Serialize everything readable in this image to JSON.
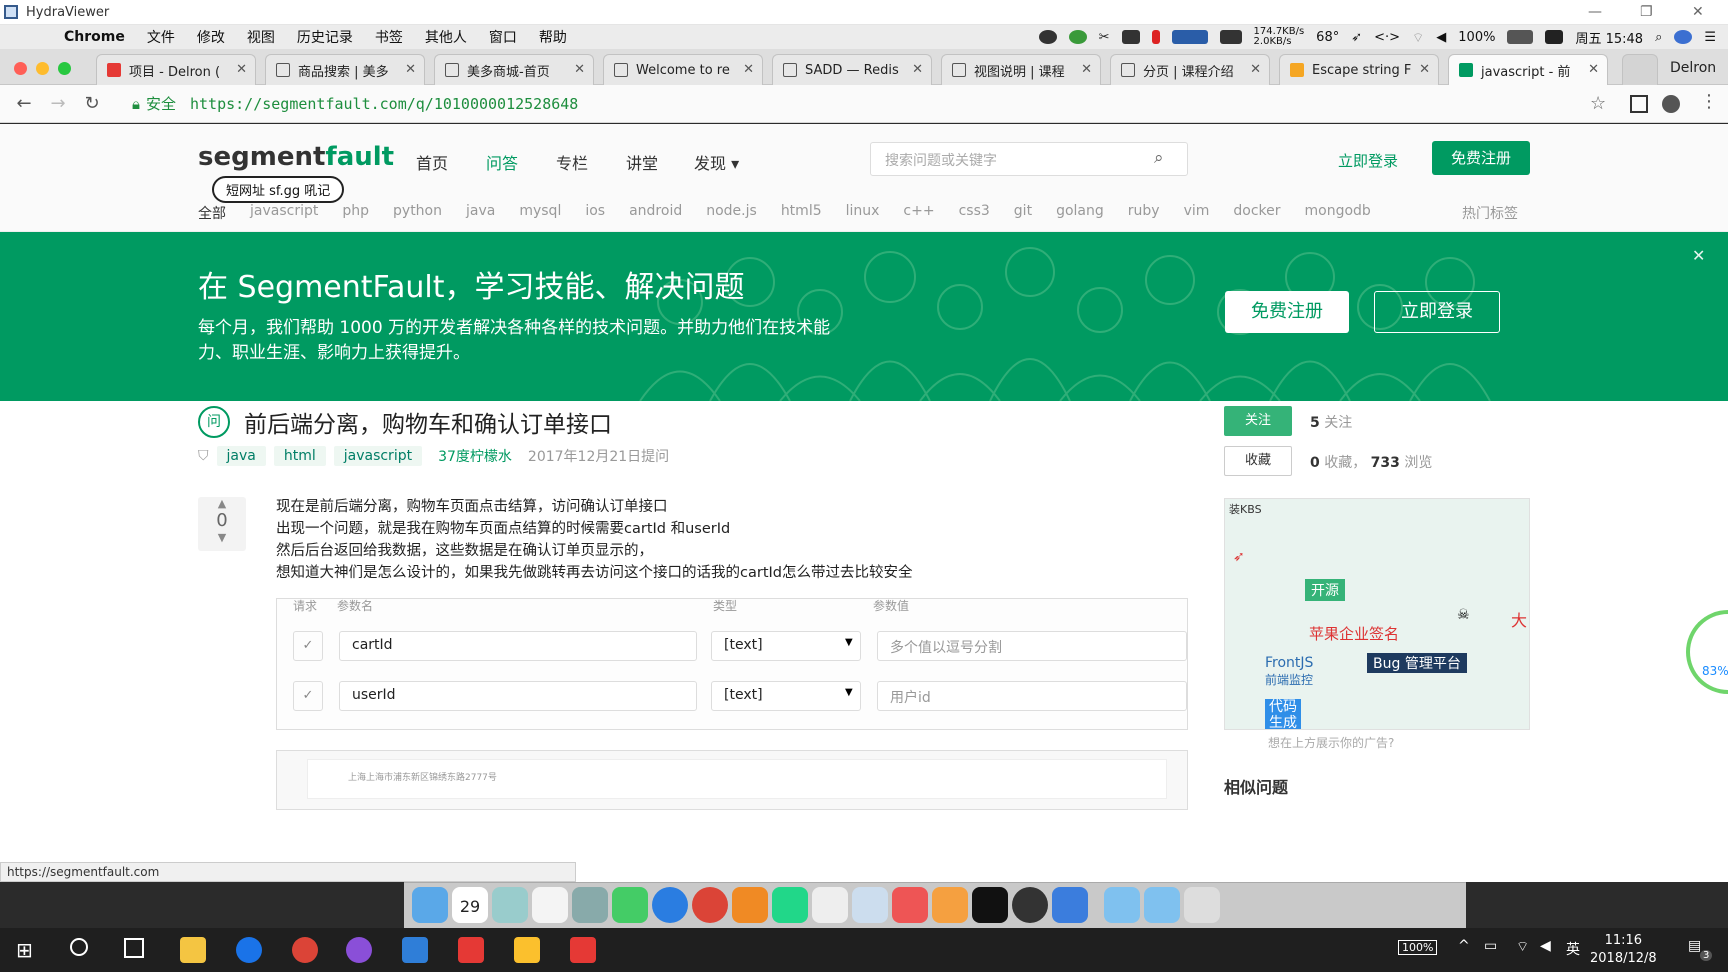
{
  "window": {
    "title": "HydraViewer"
  },
  "mac_menu": {
    "apple": "",
    "items": [
      "Chrome",
      "文件",
      "修改",
      "视图",
      "历史记录",
      "书签",
      "其他人",
      "窗口",
      "帮助"
    ],
    "net_speed": "174.7KB/s\n2.0KB/s",
    "temp": "68°",
    "battery": "100%",
    "clock": "周五 15:48"
  },
  "tabs": [
    {
      "label": "项目 - Delron (",
      "active": false
    },
    {
      "label": "商品搜索 | 美多",
      "active": false
    },
    {
      "label": "美多商城-首页",
      "active": false
    },
    {
      "label": "Welcome to re",
      "active": false
    },
    {
      "label": "SADD — Redis",
      "active": false
    },
    {
      "label": "视图说明 | 课程",
      "active": false
    },
    {
      "label": "分页 | 课程介绍",
      "active": false
    },
    {
      "label": "Escape string F",
      "active": false
    },
    {
      "label": "javascript - 前",
      "active": true
    }
  ],
  "profile_name": "Delron",
  "address_bar": {
    "secure_label": "安全",
    "url": "https://segmentfault.com/q/1010000012528648"
  },
  "sf": {
    "logo_main": "segment",
    "logo_accent": "fault",
    "short_url_bubble": "短网址 sf.gg 吼记",
    "nav": [
      "首页",
      "问答",
      "专栏",
      "讲堂",
      "发现 ▾"
    ],
    "search_placeholder": "搜索问题或关键字",
    "login": "立即登录",
    "register": "免费注册",
    "tags": [
      "全部",
      "javascript",
      "php",
      "python",
      "java",
      "mysql",
      "ios",
      "android",
      "node.js",
      "html5",
      "linux",
      "c++",
      "css3",
      "git",
      "golang",
      "ruby",
      "vim",
      "docker",
      "mongodb"
    ],
    "hot_tags": "热门标签"
  },
  "banner": {
    "title": "在 SegmentFault，学习技能、解决问题",
    "desc": "每个月，我们帮助 1000 万的开发者解决各种各样的技术问题。并助力他们在技术能力、职业生涯、影响力上获得提升。",
    "btn_register": "免费注册",
    "btn_login": "立即登录",
    "close": "✕"
  },
  "question": {
    "icon": "问",
    "title": "前后端分离，购物车和确认订单接口",
    "tags": [
      "java",
      "html",
      "javascript"
    ],
    "author": "37度柠檬水",
    "time": "2017年12月21日提问",
    "votes": "0",
    "body": [
      "现在是前后端分离，购物车页面点击结算，访问确认订单接口",
      "出现一个问题，就是我在购物车页面点结算的时候需要cartId 和userId",
      "然后后台返回给我数据，这些数据是在确认订单页显示的，",
      "想知道大神们是怎么设计的，如果我先做跳转再去访问这个接口的话我的cartId怎么带过去比较安全"
    ],
    "screenshot": {
      "headers": [
        "请求",
        "参数名",
        "类型",
        "参数值"
      ],
      "rows": [
        {
          "name": "cartId",
          "type": "[text]",
          "value": "多个值以逗号分割"
        },
        {
          "name": "userId",
          "type": "[text]",
          "value": "用户id"
        }
      ],
      "second_snippet": "上海上海市浦东新区锦绣东路2777号"
    }
  },
  "sidebar": {
    "follow_btn": "关注",
    "follow_count": "5",
    "follow_label": "关注",
    "collect_btn": "收藏",
    "collect_count": "0",
    "collect_label": "收藏，",
    "view_count": "733",
    "view_label": "浏览",
    "ad_texts": {
      "kbs": "装KBS",
      "open_source": "开源",
      "apple_sign": "苹果企业签名",
      "big": "大",
      "frontjs": "FrontJS",
      "frontjs_sub": "前端监控",
      "bug": "Bug 管理平台",
      "codegen": "代码\n生成"
    },
    "ad_hint": "想在上方展示你的广告?",
    "similar_title": "相似问题"
  },
  "gauge_value": "83%",
  "status_url": "https://segmentfault.com",
  "calendar_day": "29",
  "windows_taskbar": {
    "battery": "100%",
    "ime": "英",
    "time": "11:16",
    "date": "2018/12/8",
    "notifications": "3"
  }
}
